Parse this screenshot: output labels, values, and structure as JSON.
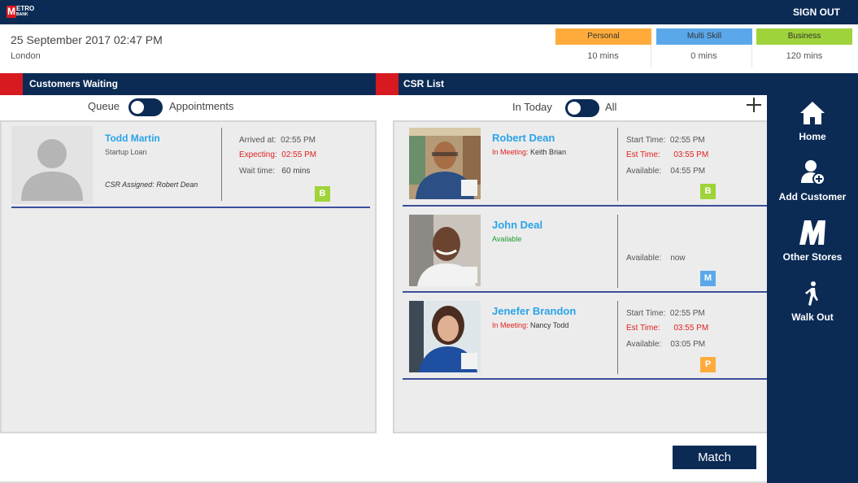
{
  "brand": {
    "logo_letter": "M",
    "logo_text_1": "ETRO",
    "logo_text_2": "BANK"
  },
  "header": {
    "signout_label": "SIGN OUT"
  },
  "info": {
    "datetime": "25 September 2017 02:47 PM",
    "location": "London"
  },
  "queues": [
    {
      "label": "Personal",
      "value": "10 mins",
      "color": "#ffab3b"
    },
    {
      "label": "Multi Skill",
      "value": "0 mins",
      "color": "#5aa8ea"
    },
    {
      "label": "Business",
      "value": "120 mins",
      "color": "#9fd33a"
    }
  ],
  "customers_section": {
    "title": "Customers Waiting",
    "toggle_left": "Queue",
    "toggle_right": "Appointments",
    "customer": {
      "name": "Todd Martin",
      "subtitle": "Startup Loan",
      "assigned": "CSR Assigned: Robert Dean",
      "arrived_label": "Arrived at:",
      "arrived_value": "02:55 PM",
      "expecting_label": "Expecting:",
      "expecting_value": "02:55 PM",
      "wait_label": "Wait time:",
      "wait_value": "60 mins",
      "badge": "B",
      "badge_color": "#9fd33a"
    }
  },
  "csr_section": {
    "title": "CSR List",
    "toggle_left": "In Today",
    "toggle_right": "All",
    "csrs": [
      {
        "name": "Robert Dean",
        "status_label": "In Meeting:",
        "status_value": "Keith Brian",
        "start_label": "Start Time:",
        "start_value": "02:55 PM",
        "est_label": "Est Time:",
        "est_value": "03:55 PM",
        "avail_label": "Available:",
        "avail_value": "04:55 PM",
        "badge": "B",
        "badge_color": "#9fd33a"
      },
      {
        "name": "John Deal",
        "status_label": "Available",
        "avail_label": "Available:",
        "avail_value": "now",
        "badge": "M",
        "badge_color": "#5aa8ea"
      },
      {
        "name": "Jenefer Brandon",
        "status_label": "In Meeting:",
        "status_value": "Nancy Todd",
        "start_label": "Start Time:",
        "start_value": "02:55 PM",
        "est_label": "Est Time:",
        "est_value": "03:55 PM",
        "avail_label": "Available:",
        "avail_value": "03:05 PM",
        "badge": "P",
        "badge_color": "#ffab3b"
      }
    ]
  },
  "sidebar": {
    "items": [
      {
        "label": "Home",
        "icon": "home-icon"
      },
      {
        "label": "Add Customer",
        "icon": "add-customer-icon"
      },
      {
        "label": "Other Stores",
        "icon": "metro-m-icon"
      },
      {
        "label": "Walk Out",
        "icon": "walking-person-icon"
      }
    ]
  },
  "actions": {
    "match_label": "Match"
  }
}
